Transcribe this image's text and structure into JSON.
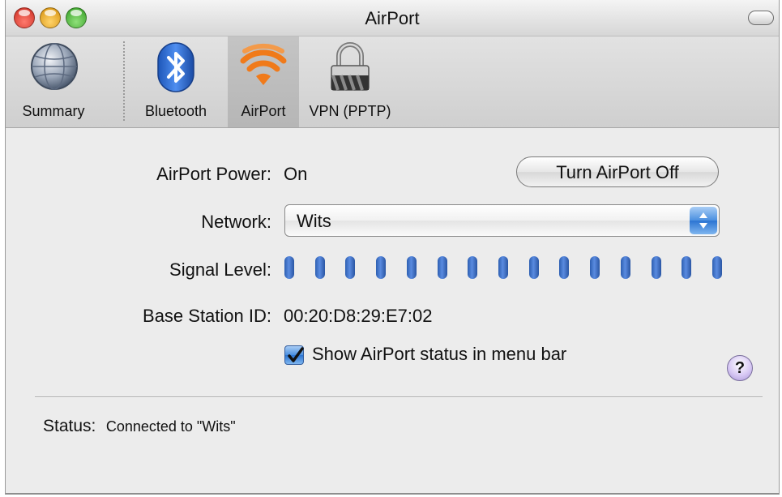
{
  "window": {
    "title": "AirPort"
  },
  "toolbar": {
    "items": [
      {
        "label": "Summary",
        "icon": "globe-icon"
      },
      {
        "label": "Bluetooth",
        "icon": "bluetooth-icon"
      },
      {
        "label": "AirPort",
        "icon": "airport-wifi-icon",
        "selected": true
      },
      {
        "label": "VPN (PPTP)",
        "icon": "lock-icon"
      }
    ]
  },
  "airport": {
    "power_label": "AirPort Power:",
    "power_value": "On",
    "toggle_button": "Turn AirPort Off",
    "network_label": "Network:",
    "network_value": "Wits",
    "signal_label": "Signal Level:",
    "signal_bars": 15,
    "base_station_label": "Base Station ID:",
    "base_station_value": "00:20:D8:29:E7:02",
    "menu_bar_checkbox_label": "Show AirPort status in menu bar",
    "menu_bar_checkbox_checked": true
  },
  "status": {
    "label": "Status:",
    "value": "Connected to \"Wits\""
  },
  "help": {
    "glyph": "?"
  },
  "colors": {
    "aqua_blue": "#2b74d2",
    "signal_blue": "#3a6cc4",
    "airport_orange": "#f07a1a"
  }
}
